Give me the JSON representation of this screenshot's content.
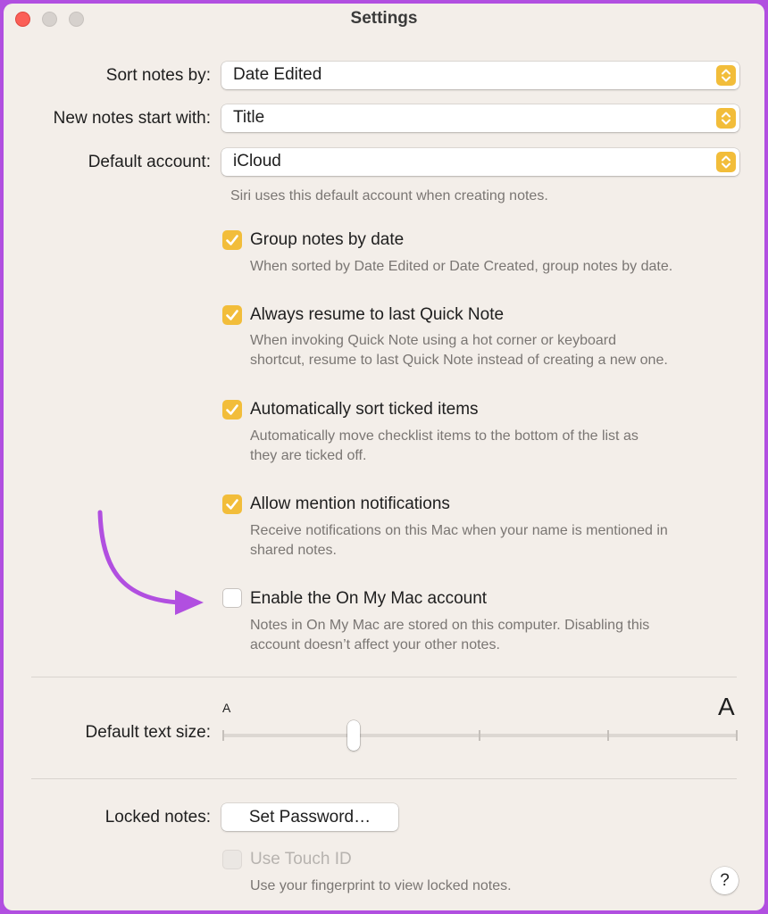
{
  "window": {
    "title": "Settings"
  },
  "sort_notes": {
    "label": "Sort notes by:",
    "value": "Date Edited"
  },
  "new_notes": {
    "label": "New notes start with:",
    "value": "Title"
  },
  "default_account": {
    "label": "Default account:",
    "value": "iCloud",
    "note": "Siri uses this default account when creating notes."
  },
  "options": [
    {
      "label": "Group notes by date",
      "checked": true,
      "desc": "When sorted by Date Edited or Date Created, group notes by date."
    },
    {
      "label": "Always resume to last Quick Note",
      "checked": true,
      "desc1": "When invoking Quick Note using a hot corner or keyboard",
      "desc2": "shortcut, resume to last Quick Note instead of creating a new one."
    },
    {
      "label": "Automatically sort ticked items",
      "checked": true,
      "desc1": "Automatically move checklist items to the bottom of the list as",
      "desc2": "they are ticked off."
    },
    {
      "label": "Allow mention notifications",
      "checked": true,
      "desc1": "Receive notifications on this Mac when your name is mentioned in",
      "desc2": "shared notes."
    },
    {
      "label": "Enable the On My Mac account",
      "checked": false,
      "desc1": "Notes in On My Mac are stored on this computer. Disabling this",
      "desc2": "account doesn’t affect your other notes."
    }
  ],
  "text_size": {
    "label": "Default text size:",
    "small_glyph": "A",
    "large_glyph": "A",
    "level": 0.25,
    "steps": 5
  },
  "locked_notes": {
    "label": "Locked notes:",
    "button": "Set Password…",
    "touch_id_label": "Use Touch ID",
    "touch_id_desc": "Use your fingerprint to view locked notes."
  },
  "help": {
    "label": "?"
  },
  "colors": {
    "accent": "#f2bd3a",
    "annotation_arrow": "#b14fe0",
    "background": "#f3eee9"
  }
}
